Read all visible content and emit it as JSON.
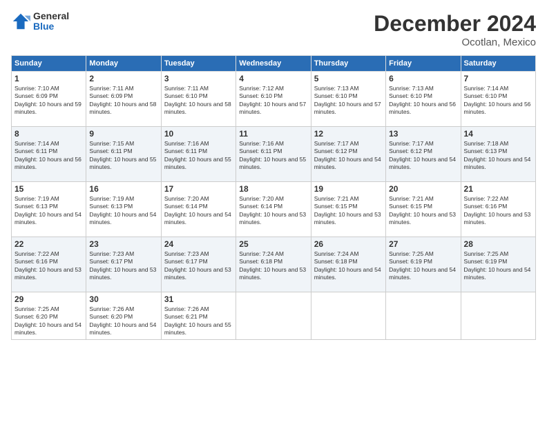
{
  "logo": {
    "general": "General",
    "blue": "Blue"
  },
  "title": "December 2024",
  "location": "Ocotlan, Mexico",
  "days_of_week": [
    "Sunday",
    "Monday",
    "Tuesday",
    "Wednesday",
    "Thursday",
    "Friday",
    "Saturday"
  ],
  "weeks": [
    [
      {
        "day": "1",
        "sunrise": "7:10 AM",
        "sunset": "6:09 PM",
        "daylight": "10 hours and 59 minutes."
      },
      {
        "day": "2",
        "sunrise": "7:11 AM",
        "sunset": "6:09 PM",
        "daylight": "10 hours and 58 minutes."
      },
      {
        "day": "3",
        "sunrise": "7:11 AM",
        "sunset": "6:10 PM",
        "daylight": "10 hours and 58 minutes."
      },
      {
        "day": "4",
        "sunrise": "7:12 AM",
        "sunset": "6:10 PM",
        "daylight": "10 hours and 57 minutes."
      },
      {
        "day": "5",
        "sunrise": "7:13 AM",
        "sunset": "6:10 PM",
        "daylight": "10 hours and 57 minutes."
      },
      {
        "day": "6",
        "sunrise": "7:13 AM",
        "sunset": "6:10 PM",
        "daylight": "10 hours and 56 minutes."
      },
      {
        "day": "7",
        "sunrise": "7:14 AM",
        "sunset": "6:10 PM",
        "daylight": "10 hours and 56 minutes."
      }
    ],
    [
      {
        "day": "8",
        "sunrise": "7:14 AM",
        "sunset": "6:11 PM",
        "daylight": "10 hours and 56 minutes."
      },
      {
        "day": "9",
        "sunrise": "7:15 AM",
        "sunset": "6:11 PM",
        "daylight": "10 hours and 55 minutes."
      },
      {
        "day": "10",
        "sunrise": "7:16 AM",
        "sunset": "6:11 PM",
        "daylight": "10 hours and 55 minutes."
      },
      {
        "day": "11",
        "sunrise": "7:16 AM",
        "sunset": "6:11 PM",
        "daylight": "10 hours and 55 minutes."
      },
      {
        "day": "12",
        "sunrise": "7:17 AM",
        "sunset": "6:12 PM",
        "daylight": "10 hours and 54 minutes."
      },
      {
        "day": "13",
        "sunrise": "7:17 AM",
        "sunset": "6:12 PM",
        "daylight": "10 hours and 54 minutes."
      },
      {
        "day": "14",
        "sunrise": "7:18 AM",
        "sunset": "6:13 PM",
        "daylight": "10 hours and 54 minutes."
      }
    ],
    [
      {
        "day": "15",
        "sunrise": "7:19 AM",
        "sunset": "6:13 PM",
        "daylight": "10 hours and 54 minutes."
      },
      {
        "day": "16",
        "sunrise": "7:19 AM",
        "sunset": "6:13 PM",
        "daylight": "10 hours and 54 minutes."
      },
      {
        "day": "17",
        "sunrise": "7:20 AM",
        "sunset": "6:14 PM",
        "daylight": "10 hours and 54 minutes."
      },
      {
        "day": "18",
        "sunrise": "7:20 AM",
        "sunset": "6:14 PM",
        "daylight": "10 hours and 53 minutes."
      },
      {
        "day": "19",
        "sunrise": "7:21 AM",
        "sunset": "6:15 PM",
        "daylight": "10 hours and 53 minutes."
      },
      {
        "day": "20",
        "sunrise": "7:21 AM",
        "sunset": "6:15 PM",
        "daylight": "10 hours and 53 minutes."
      },
      {
        "day": "21",
        "sunrise": "7:22 AM",
        "sunset": "6:16 PM",
        "daylight": "10 hours and 53 minutes."
      }
    ],
    [
      {
        "day": "22",
        "sunrise": "7:22 AM",
        "sunset": "6:16 PM",
        "daylight": "10 hours and 53 minutes."
      },
      {
        "day": "23",
        "sunrise": "7:23 AM",
        "sunset": "6:17 PM",
        "daylight": "10 hours and 53 minutes."
      },
      {
        "day": "24",
        "sunrise": "7:23 AM",
        "sunset": "6:17 PM",
        "daylight": "10 hours and 53 minutes."
      },
      {
        "day": "25",
        "sunrise": "7:24 AM",
        "sunset": "6:18 PM",
        "daylight": "10 hours and 53 minutes."
      },
      {
        "day": "26",
        "sunrise": "7:24 AM",
        "sunset": "6:18 PM",
        "daylight": "10 hours and 54 minutes."
      },
      {
        "day": "27",
        "sunrise": "7:25 AM",
        "sunset": "6:19 PM",
        "daylight": "10 hours and 54 minutes."
      },
      {
        "day": "28",
        "sunrise": "7:25 AM",
        "sunset": "6:19 PM",
        "daylight": "10 hours and 54 minutes."
      }
    ],
    [
      {
        "day": "29",
        "sunrise": "7:25 AM",
        "sunset": "6:20 PM",
        "daylight": "10 hours and 54 minutes."
      },
      {
        "day": "30",
        "sunrise": "7:26 AM",
        "sunset": "6:20 PM",
        "daylight": "10 hours and 54 minutes."
      },
      {
        "day": "31",
        "sunrise": "7:26 AM",
        "sunset": "6:21 PM",
        "daylight": "10 hours and 55 minutes."
      },
      null,
      null,
      null,
      null
    ]
  ],
  "labels": {
    "sunrise": "Sunrise:",
    "sunset": "Sunset:",
    "daylight": "Daylight:"
  }
}
